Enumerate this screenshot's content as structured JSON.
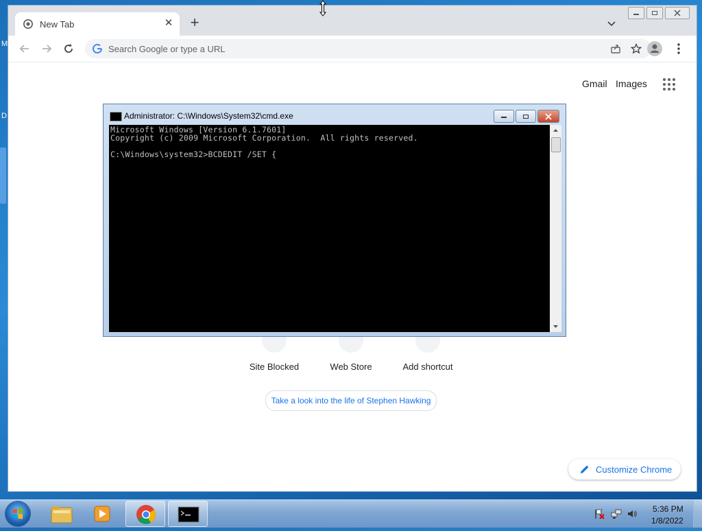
{
  "desktop": {
    "edge_letters": [
      "M",
      "D"
    ]
  },
  "chrome": {
    "tab": {
      "title": "New Tab"
    },
    "omnibox": {
      "placeholder": "Search Google or type a URL"
    },
    "header_links": {
      "gmail": "Gmail",
      "images": "Images"
    },
    "shortcuts": [
      {
        "label": "Site Blocked"
      },
      {
        "label": "Web Store"
      },
      {
        "label": "Add shortcut"
      }
    ],
    "promo": "Take a look into the life of Stephen Hawking",
    "customize_label": "Customize Chrome"
  },
  "cmd": {
    "title": "Administrator: C:\\Windows\\System32\\cmd.exe",
    "lines": [
      "Microsoft Windows [Version 6.1.7601]",
      "Copyright (c) 2009 Microsoft Corporation.  All rights reserved.",
      "",
      "C:\\Windows\\system32>BCDEDIT /SET {"
    ]
  },
  "taskbar": {
    "items": [
      {
        "name": "Windows Explorer"
      },
      {
        "name": "Windows Media Player"
      },
      {
        "name": "Google Chrome",
        "active": true
      },
      {
        "name": "Command Prompt",
        "active": true
      }
    ],
    "clock": {
      "time": "5:36 PM",
      "date": "1/8/2022"
    }
  },
  "colors": {
    "chrome_frame": "#dee1e6",
    "accent_blue": "#1a73e8",
    "cmd_background": "#000000",
    "cmd_text": "#c0c0c0"
  }
}
